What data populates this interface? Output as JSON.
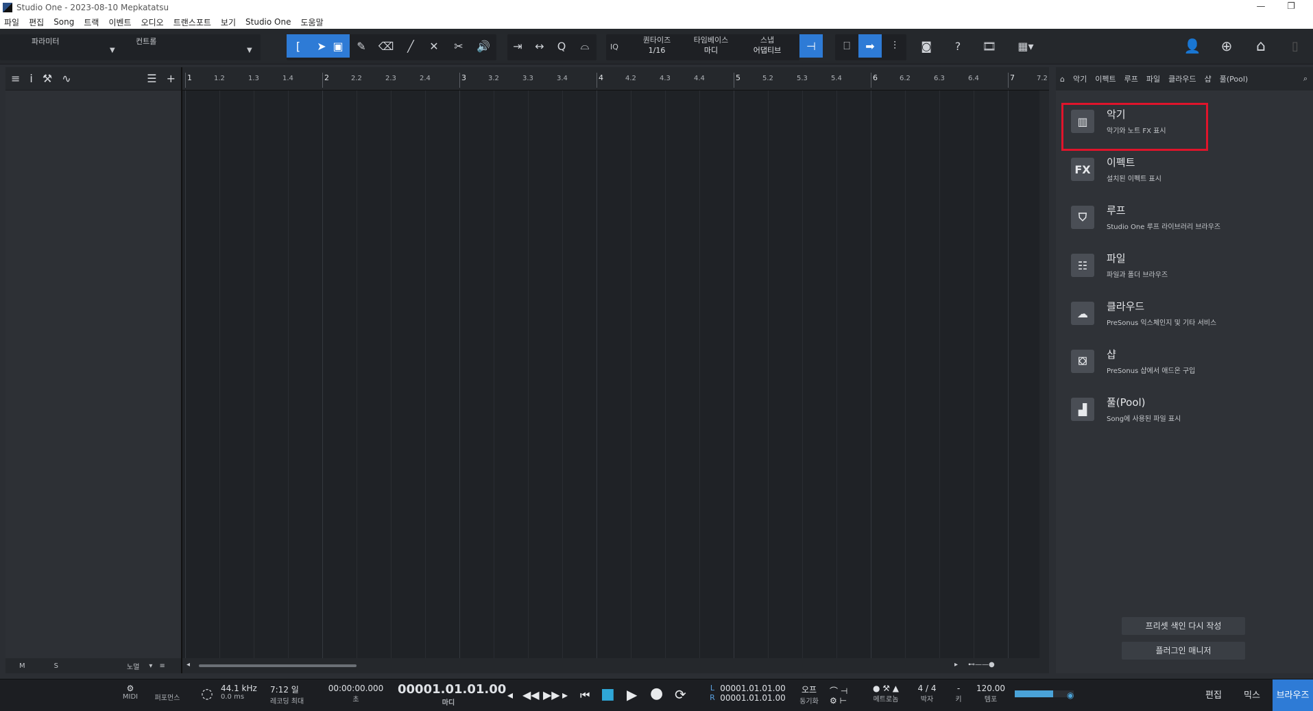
{
  "window": {
    "title": "Studio One - 2023-08-10 Mepkatatsu",
    "min": "—",
    "restore": "❐"
  },
  "menu": [
    "파일",
    "편집",
    "Song",
    "트랙",
    "이벤트",
    "오디오",
    "트랜스포트",
    "보기",
    "Studio One",
    "도움말"
  ],
  "toolbar": {
    "param_label": "파라미터",
    "control_label": "컨트롤",
    "iq": "IQ",
    "quantize_label": "퀀타이즈",
    "quantize_value": "1/16",
    "timebase_label": "타임베이스",
    "timebase_value": "마디",
    "snap_label": "스냅",
    "snap_value": "어댑티브",
    "help": "?"
  },
  "ruler": {
    "major": [
      "1",
      "2",
      "3",
      "4",
      "5",
      "6",
      "7"
    ],
    "minor": [
      [
        "1.2",
        "1.3",
        "1.4"
      ],
      [
        "2.2",
        "2.3",
        "2.4"
      ],
      [
        "3.2",
        "3.3",
        "3.4"
      ],
      [
        "4.2",
        "4.3",
        "4.4"
      ],
      [
        "5.2",
        "5.3",
        "5.4"
      ],
      [
        "6.2",
        "6.3",
        "6.4"
      ],
      [
        "7.2"
      ]
    ]
  },
  "inspector_footer": {
    "m": "M",
    "s": "S",
    "mode": "노멀"
  },
  "browser": {
    "tabs": [
      "악기",
      "이펙트",
      "루프",
      "파일",
      "클라우드",
      "샵",
      "풀(Pool)"
    ],
    "items": [
      {
        "title": "악기",
        "desc": "악기와 노트 FX 표시",
        "icon": "piano-icon"
      },
      {
        "title": "이펙트",
        "desc": "설치된 이펙트 표시",
        "icon": "fx-icon"
      },
      {
        "title": "루프",
        "desc": "Studio One 루프 라이브러리 브라우즈",
        "icon": "loop-icon"
      },
      {
        "title": "파일",
        "desc": "파일과 폴더 브라우즈",
        "icon": "file-icon"
      },
      {
        "title": "클라우드",
        "desc": "PreSonus 익스체인지 및 기타 서비스",
        "icon": "cloud-icon"
      },
      {
        "title": "샵",
        "desc": "PreSonus 샵에서 애드온 구입",
        "icon": "shop-icon"
      },
      {
        "title": "풀(Pool)",
        "desc": "Song에 사용된 파일 표시",
        "icon": "pool-icon"
      }
    ],
    "fx_glyph": "FX",
    "rebuild_preset_index": "프리셋 색인 다시 작성",
    "plugin_manager": "플러그인 매니저"
  },
  "transport": {
    "midi": "MIDI",
    "performance": "퍼포먼스",
    "sample_rate": "44.1 kHz",
    "latency": "0.0 ms",
    "record_time": "7:12 일",
    "record_max": "레코딩 최대",
    "seconds_time": "00:00:00.000",
    "seconds_unit": "초",
    "bars_time": "00001.01.01.00",
    "bars_unit": "마디",
    "loop_l": "00001.01.01.00",
    "loop_r": "00001.01.01.00",
    "l": "L",
    "r": "R",
    "sync_value": "오프",
    "sync_label": "동기화",
    "metronome": "메트로놈",
    "signature": "4 / 4",
    "signature_label": "박자",
    "key_value": "-",
    "key_label": "키",
    "tempo": "120.00",
    "tempo_label": "템포",
    "edit": "편집",
    "mix": "믹스",
    "browse": "브라우즈"
  }
}
